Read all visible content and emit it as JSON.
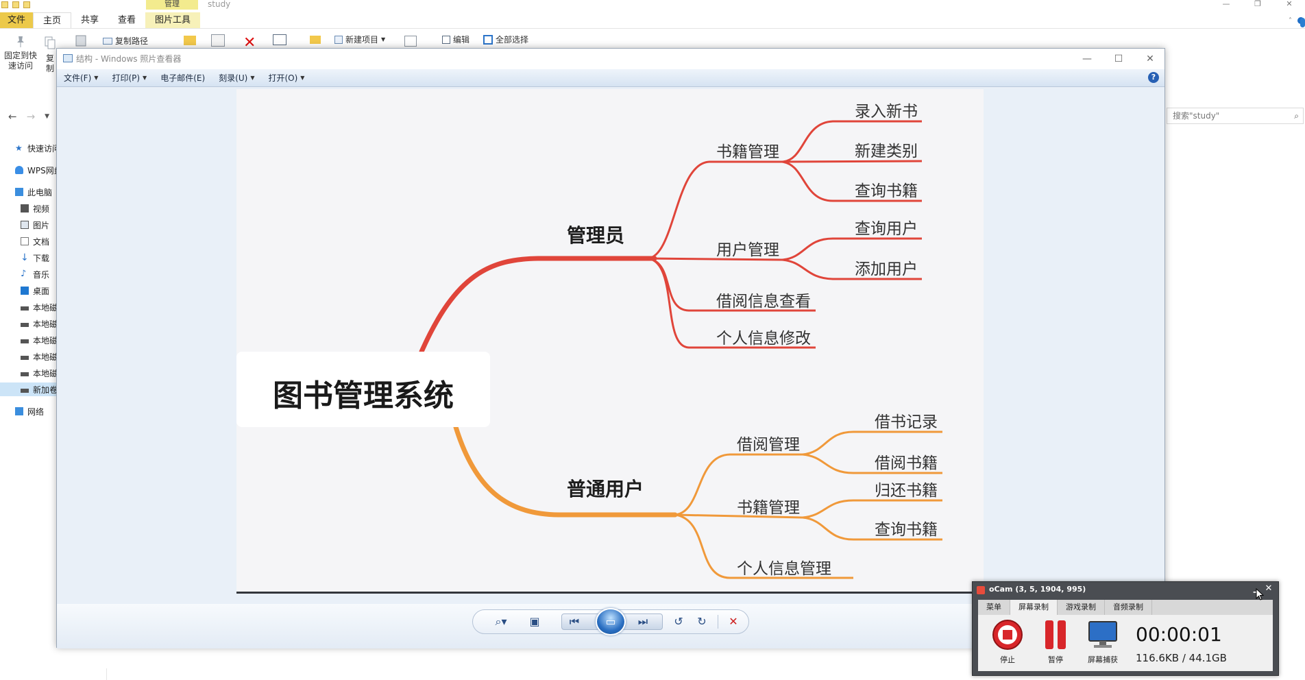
{
  "explorer": {
    "title": "study",
    "context_tab": "管理",
    "tabs": [
      "文件",
      "主页",
      "共享",
      "查看",
      "图片工具"
    ],
    "ribbon": {
      "pin_label_1": "固定到快",
      "pin_label_2": "速访问",
      "copy_label": "复制",
      "copy_path": "复制路径",
      "new_item": "新建项目",
      "edit": "编辑",
      "select_all": "全部选择"
    },
    "search_placeholder": "搜索\"study\"",
    "tree": [
      "快速访问",
      "WPS网盘",
      "此电脑",
      "视频",
      "图片",
      "文档",
      "下载",
      "音乐",
      "桌面",
      "本地磁",
      "本地磁",
      "本地磁",
      "本地磁",
      "本地磁",
      "新加卷",
      "网络"
    ]
  },
  "viewer": {
    "title": "结构 - Windows 照片查看器",
    "menus": [
      "文件(F)",
      "打印(P)",
      "电子邮件(E)",
      "刻录(U)",
      "打开(O)"
    ],
    "menu_has_dropdown": [
      true,
      true,
      false,
      true,
      true
    ],
    "help": "?"
  },
  "mindmap": {
    "root": "图书管理系统",
    "admin": "管理员",
    "user": "普通用户",
    "admin_children": [
      "书籍管理",
      "用户管理",
      "借阅信息查看",
      "个人信息修改"
    ],
    "admin_books": [
      "录入新书",
      "新建类别",
      "查询书籍"
    ],
    "admin_users": [
      "查询用户",
      "添加用户"
    ],
    "user_children": [
      "借阅管理",
      "书籍管理",
      "个人信息管理"
    ],
    "user_borrow": [
      "借书记录",
      "借阅书籍"
    ],
    "user_books": [
      "归还书籍",
      "查询书籍"
    ],
    "colors": {
      "admin": "#e0453a",
      "user": "#f0993a"
    }
  },
  "ocam": {
    "title": "oCam (3, 5, 1904, 995)",
    "tabs": [
      "菜单",
      "屏幕录制",
      "游戏录制",
      "音频录制"
    ],
    "stop": "停止",
    "pause": "暂停",
    "capture": "屏幕捕获",
    "time": "00:00:01",
    "size": "116.6KB / 44.1GB"
  }
}
